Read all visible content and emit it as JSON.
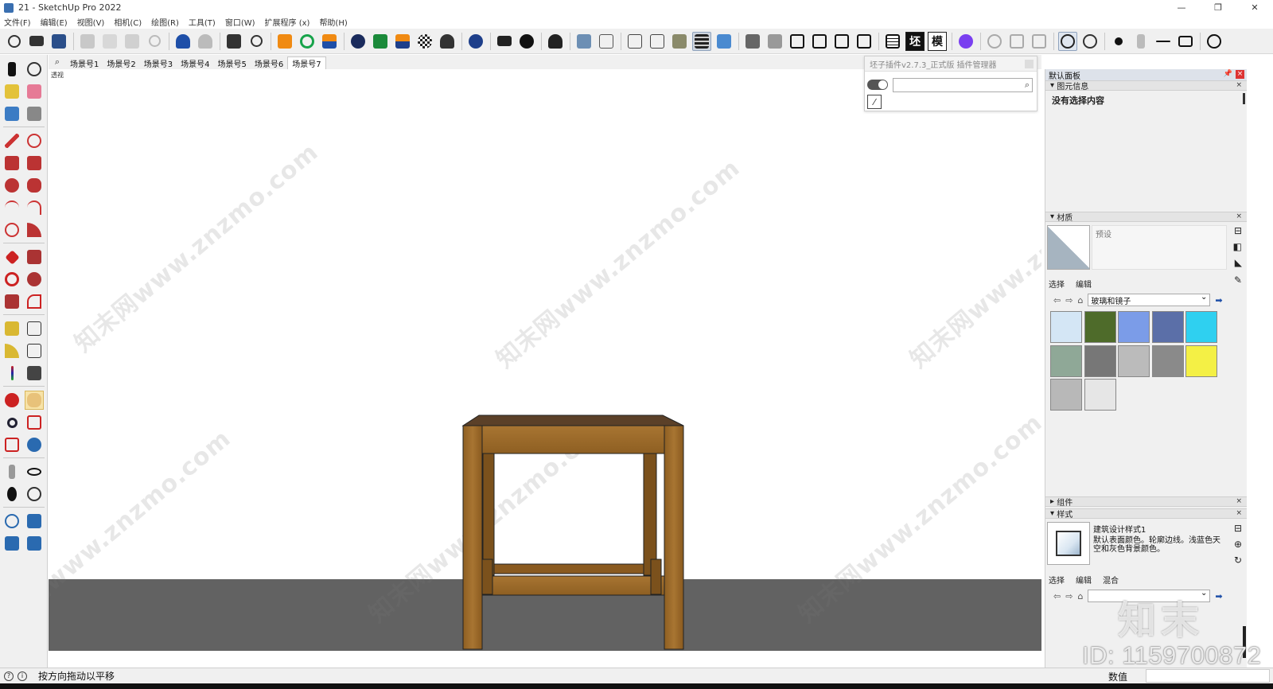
{
  "window": {
    "title": "21 - SketchUp Pro 2022",
    "controls": [
      "—",
      "❐",
      "✕"
    ]
  },
  "menu": [
    "文件(F)",
    "编辑(E)",
    "视图(V)",
    "相机(C)",
    "绘图(R)",
    "工具(T)",
    "窗口(W)",
    "扩展程序 (x)",
    "帮助(H)"
  ],
  "toolbar": {
    "text_buttons": [
      "坯",
      "模"
    ]
  },
  "scenes": {
    "tabs": [
      "场景号1",
      "场景号2",
      "场景号3",
      "场景号4",
      "场景号5",
      "场景号6",
      "场景号7"
    ],
    "active": "场景号7"
  },
  "viewport": {
    "camera_label": "透视",
    "sky_color": "#ffffff",
    "ground_color": "#626262"
  },
  "watermark": {
    "text": "知末网www.znzmo.com",
    "id": "ID: 1159700872",
    "logo": "知末"
  },
  "plugin_manager": {
    "title": "坯子插件v2.7.3_正式版 插件管理器",
    "search_value": ""
  },
  "tray": {
    "title": "默认面板",
    "entity_info": {
      "header": "图元信息",
      "body": "没有选择内容"
    },
    "materials": {
      "header": "材质",
      "name": "预设",
      "tabs": [
        "选择",
        "编辑"
      ],
      "collection": "玻璃和镜子",
      "swatches": [
        {
          "name": "translucent-glass-blue",
          "color": "#d4e6f5"
        },
        {
          "name": "glass-green",
          "color": "#4e6b2a"
        },
        {
          "name": "glass-blue",
          "color": "#7b9ce8"
        },
        {
          "name": "sky-reflection",
          "color": "#5b6fa8"
        },
        {
          "name": "cyan-glass",
          "color": "#2fd0f0"
        },
        {
          "name": "frosted-green",
          "color": "#8fa897"
        },
        {
          "name": "mosaic-glass",
          "color": "#777777"
        },
        {
          "name": "speckled-glass",
          "color": "#bbbbbb"
        },
        {
          "name": "grey-glass",
          "color": "#8a8a8a"
        },
        {
          "name": "yellow-glass",
          "color": "#f4f045"
        },
        {
          "name": "grey-gradient",
          "color": "#b8b8b8"
        },
        {
          "name": "white-gradient",
          "color": "#e6e6e6"
        }
      ]
    },
    "components": {
      "header": "组件"
    },
    "styles": {
      "header": "样式",
      "name": "建筑设计样式1",
      "description": "默认表面颜色。轮廓边线。浅蓝色天空和灰色背景颜色。",
      "tabs": [
        "选择",
        "编辑",
        "混合"
      ]
    }
  },
  "status": {
    "message": "按方向拖动以平移",
    "value_label": "数值",
    "value": ""
  }
}
